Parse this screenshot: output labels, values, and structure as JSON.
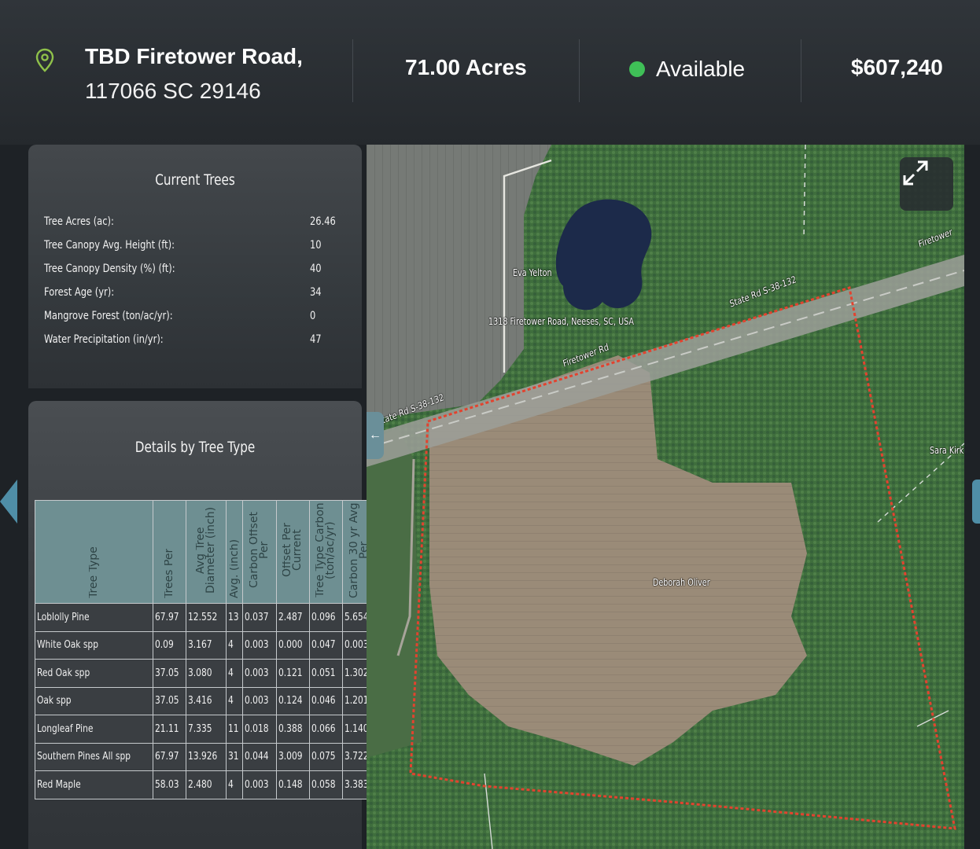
{
  "header": {
    "address_line1": "TBD Firetower Road,",
    "address_line2": "117066 SC 29146",
    "acres": "71.00 Acres",
    "status": "Available",
    "price": "$607,240",
    "pin_icon": "location-pin-icon",
    "status_color": "#3fbf57",
    "pin_color": "#8fc14a"
  },
  "current_trees": {
    "title": "Current Trees",
    "rows": [
      {
        "label": "Tree Acres (ac):",
        "value": "26.46"
      },
      {
        "label": "Tree Canopy Avg. Height (ft):",
        "value": "10"
      },
      {
        "label": "Tree Canopy Density (%) (ft):",
        "value": "40"
      },
      {
        "label": "Forest Age (yr):",
        "value": "34"
      },
      {
        "label": "Mangrove Forest (ton/ac/yr):",
        "value": "0"
      },
      {
        "label": "Water Precipitation (in/yr):",
        "value": "47"
      }
    ]
  },
  "details": {
    "title": "Details by Tree Type",
    "headers": [
      "Tree Type",
      "Trees Per",
      "Avg Tree Diameter (inch)",
      "Avg. (inch)",
      "Carbon Offset Per",
      "Offset Per Current",
      "Tree Type Carbon (ton/ac/yr)",
      "Carbon 30 yr Avg Per"
    ],
    "rows": [
      [
        "Loblolly Pine",
        "67.97",
        "12.552",
        "13",
        "0.037",
        "2.487",
        "0.096",
        "5.654"
      ],
      [
        "White Oak spp",
        "0.09",
        "3.167",
        "4",
        "0.003",
        "0.000",
        "0.047",
        "0.003"
      ],
      [
        "Red Oak spp",
        "37.05",
        "3.080",
        "4",
        "0.003",
        "0.121",
        "0.051",
        "1.302"
      ],
      [
        "Oak spp",
        "37.05",
        "3.416",
        "4",
        "0.003",
        "0.124",
        "0.046",
        "1.201"
      ],
      [
        "Longleaf Pine",
        "21.11",
        "7.335",
        "11",
        "0.018",
        "0.388",
        "0.066",
        "1.140"
      ],
      [
        "Southern Pines All spp",
        "67.97",
        "13.926",
        "31",
        "0.044",
        "3.009",
        "0.075",
        "3.722"
      ],
      [
        "Red Maple",
        "58.03",
        "2.480",
        "4",
        "0.003",
        "0.148",
        "0.058",
        "3.383"
      ]
    ]
  },
  "map": {
    "labels": {
      "eva": "Eva Yelton",
      "address": "1318 Firetower Road, Neeses, SC, USA",
      "firetower": "Firetower Rd",
      "state_rd_left": "State Rd S-38-132",
      "state_rd_right": "State Rd S-38-132",
      "firetower_right": "Firetower",
      "deborah": "Deborah Oliver",
      "sara": "Sara Kirk"
    },
    "expand_icon": "expand-icon",
    "collapse_icon": "chevron-left-icon",
    "boundary_color": "#e2432f"
  }
}
